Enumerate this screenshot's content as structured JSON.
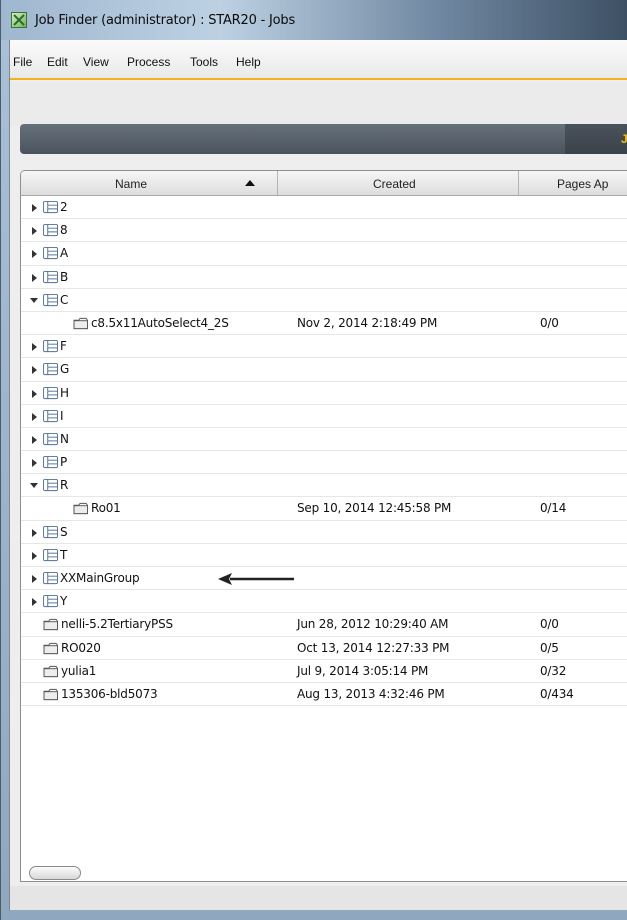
{
  "window": {
    "title": "Job Finder (administrator) : STAR20 - Jobs"
  },
  "menu": [
    "File",
    "Edit",
    "View",
    "Process",
    "Tools",
    "Help"
  ],
  "tab_letter": "J",
  "columns": {
    "name": "Name",
    "created": "Created",
    "pages": "Pages Ap"
  },
  "rows": [
    {
      "type": "group",
      "state": "closed",
      "name": "2",
      "created": "",
      "pages": ""
    },
    {
      "type": "group",
      "state": "closed",
      "name": "8",
      "created": "",
      "pages": ""
    },
    {
      "type": "group",
      "state": "closed",
      "name": "A",
      "created": "",
      "pages": ""
    },
    {
      "type": "group",
      "state": "closed",
      "name": "B",
      "created": "",
      "pages": ""
    },
    {
      "type": "group",
      "state": "open",
      "name": "C",
      "created": "",
      "pages": ""
    },
    {
      "type": "job",
      "indent": true,
      "name": "c8.5x11AutoSelect4_2S",
      "created": "Nov 2, 2014 2:18:49 PM",
      "pages": "0/0"
    },
    {
      "type": "group",
      "state": "closed",
      "name": "F",
      "created": "",
      "pages": ""
    },
    {
      "type": "group",
      "state": "closed",
      "name": "G",
      "created": "",
      "pages": ""
    },
    {
      "type": "group",
      "state": "closed",
      "name": "H",
      "created": "",
      "pages": ""
    },
    {
      "type": "group",
      "state": "closed",
      "name": "I",
      "created": "",
      "pages": ""
    },
    {
      "type": "group",
      "state": "closed",
      "name": "N",
      "created": "",
      "pages": ""
    },
    {
      "type": "group",
      "state": "closed",
      "name": "P",
      "created": "",
      "pages": ""
    },
    {
      "type": "group",
      "state": "open",
      "name": "R",
      "created": "",
      "pages": ""
    },
    {
      "type": "job",
      "indent": true,
      "name": "Ro01",
      "created": "Sep 10, 2014 12:45:58 PM",
      "pages": "0/14"
    },
    {
      "type": "group",
      "state": "closed",
      "name": "S",
      "created": "",
      "pages": ""
    },
    {
      "type": "group",
      "state": "closed",
      "name": "T",
      "created": "",
      "pages": ""
    },
    {
      "type": "group",
      "state": "closed",
      "name": "XXMainGroup",
      "created": "",
      "pages": "",
      "annotated": true
    },
    {
      "type": "group",
      "state": "closed",
      "name": "Y",
      "created": "",
      "pages": ""
    },
    {
      "type": "job",
      "indent": false,
      "name": "nelli-5.2TertiaryPSS",
      "created": "Jun 28, 2012 10:29:40 AM",
      "pages": "0/0"
    },
    {
      "type": "job",
      "indent": false,
      "name": "RO020",
      "created": "Oct 13, 2014 12:27:33 PM",
      "pages": "0/5"
    },
    {
      "type": "job",
      "indent": false,
      "name": "yulia1",
      "created": "Jul 9, 2014 3:05:14 PM",
      "pages": "0/32"
    },
    {
      "type": "job",
      "indent": false,
      "name": "135306-bld5073",
      "created": "Aug 13, 2013 4:32:46 PM",
      "pages": "0/434"
    }
  ],
  "icons": {
    "group": "folder-group-icon",
    "job": "job-folder-icon",
    "sort": "sort-ascending-icon",
    "annotation": "left-arrow-annotation-icon"
  },
  "colors": {
    "accent": "#f2b21a",
    "tab_text": "#f3c318",
    "darkbar": "#555e68"
  }
}
